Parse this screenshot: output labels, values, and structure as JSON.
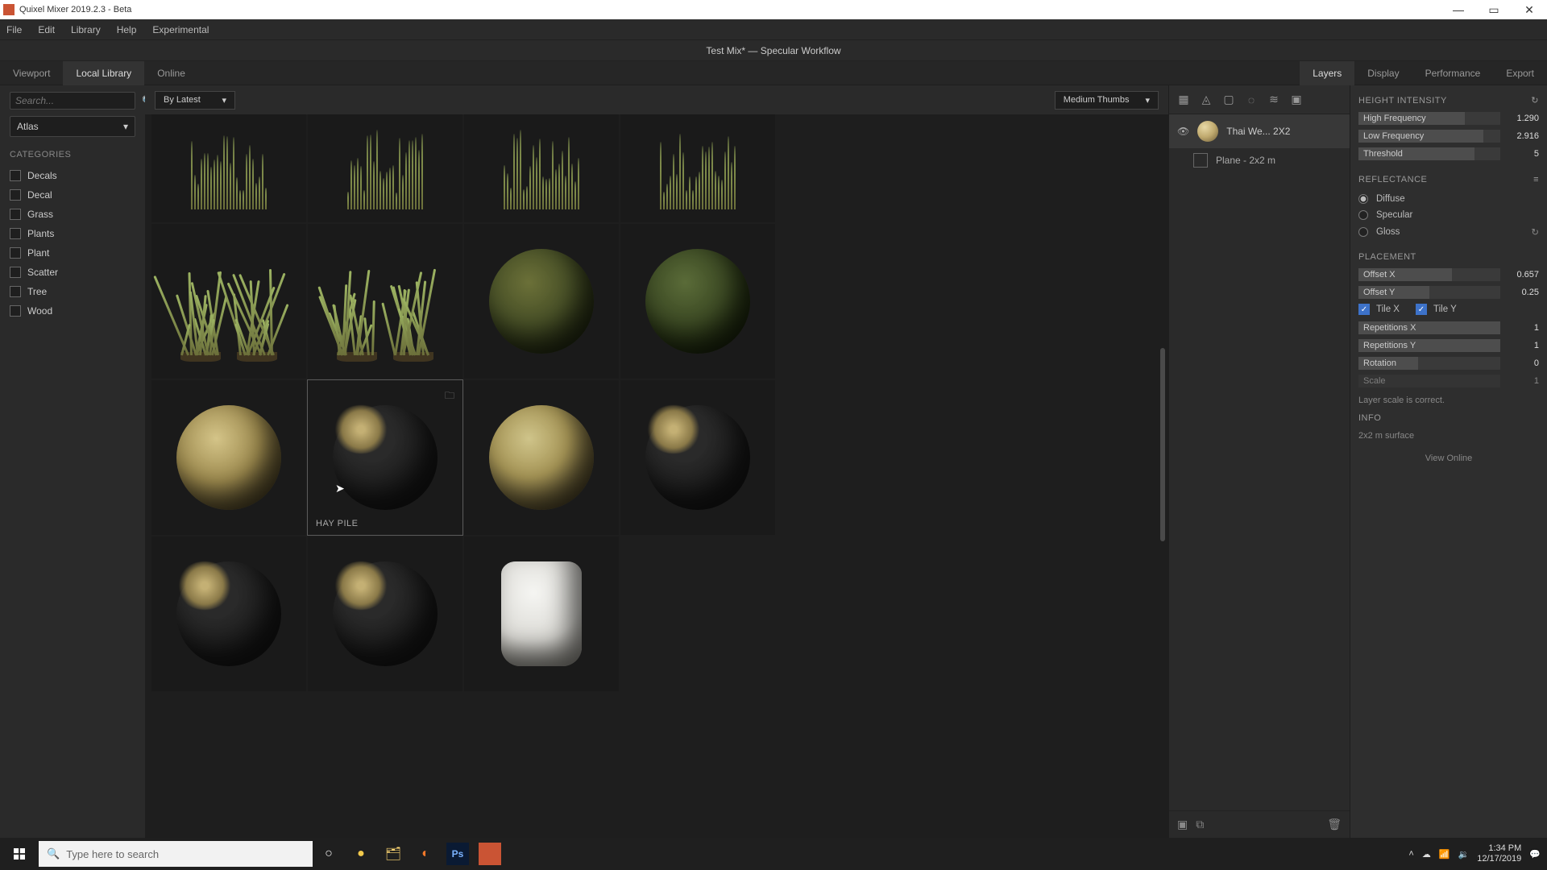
{
  "app": {
    "title": "Quixel Mixer 2019.2.3 - Beta"
  },
  "menu": [
    "File",
    "Edit",
    "Library",
    "Help",
    "Experimental"
  ],
  "document": {
    "title": "Test Mix* — Specular Workflow"
  },
  "leftTabs": [
    {
      "label": "Viewport",
      "active": false
    },
    {
      "label": "Local Library",
      "active": true
    },
    {
      "label": "Online",
      "active": false
    }
  ],
  "rightTabs": [
    {
      "label": "Layers",
      "active": true
    },
    {
      "label": "Display",
      "active": false
    },
    {
      "label": "Performance",
      "active": false
    },
    {
      "label": "Export",
      "active": false
    }
  ],
  "search": {
    "placeholder": "Search..."
  },
  "libraryFilter": {
    "label": "Atlas"
  },
  "categoriesHeading": "CATEGORIES",
  "categories": [
    "Decals",
    "Decal",
    "Grass",
    "Plants",
    "Plant",
    "Scatter",
    "Tree",
    "Wood"
  ],
  "sortDropdown": "By Latest",
  "sizeDropdown": "Medium Thumbs",
  "hoveredItem": {
    "label": "HAY PILE"
  },
  "layers": {
    "items": [
      {
        "name": "Thai We... 2X2"
      }
    ],
    "sub": {
      "name": "Plane - 2x2 m"
    }
  },
  "props": {
    "heightHeading": "HEIGHT INTENSITY",
    "highFreq": {
      "label": "High Frequency",
      "value": "1.290",
      "fill": 75
    },
    "lowFreq": {
      "label": "Low Frequency",
      "value": "2.916",
      "fill": 88
    },
    "threshold": {
      "label": "Threshold",
      "value": "5",
      "fill": 82
    },
    "reflectanceHeading": "REFLECTANCE",
    "reflectance": [
      "Diffuse",
      "Specular",
      "Gloss"
    ],
    "reflectanceSelected": 0,
    "placementHeading": "PLACEMENT",
    "offsetX": {
      "label": "Offset X",
      "value": "0.657",
      "fill": 66
    },
    "offsetY": {
      "label": "Offset Y",
      "value": "0.25",
      "fill": 50
    },
    "tileX": {
      "label": "Tile X"
    },
    "tileY": {
      "label": "Tile Y"
    },
    "repX": {
      "label": "Repetitions X",
      "value": "1",
      "fill": 100
    },
    "repY": {
      "label": "Repetitions Y",
      "value": "1",
      "fill": 100
    },
    "rotation": {
      "label": "Rotation",
      "value": "0",
      "fill": 42
    },
    "scale": {
      "label": "Scale",
      "value": "1"
    },
    "scaleNote": "Layer scale is correct.",
    "infoHeading": "INFO",
    "infoText": "2x2 m surface",
    "viewOnline": "View Online"
  },
  "taskbar": {
    "searchPlaceholder": "Type here to search",
    "time": "1:34 PM",
    "date": "12/17/2019"
  }
}
